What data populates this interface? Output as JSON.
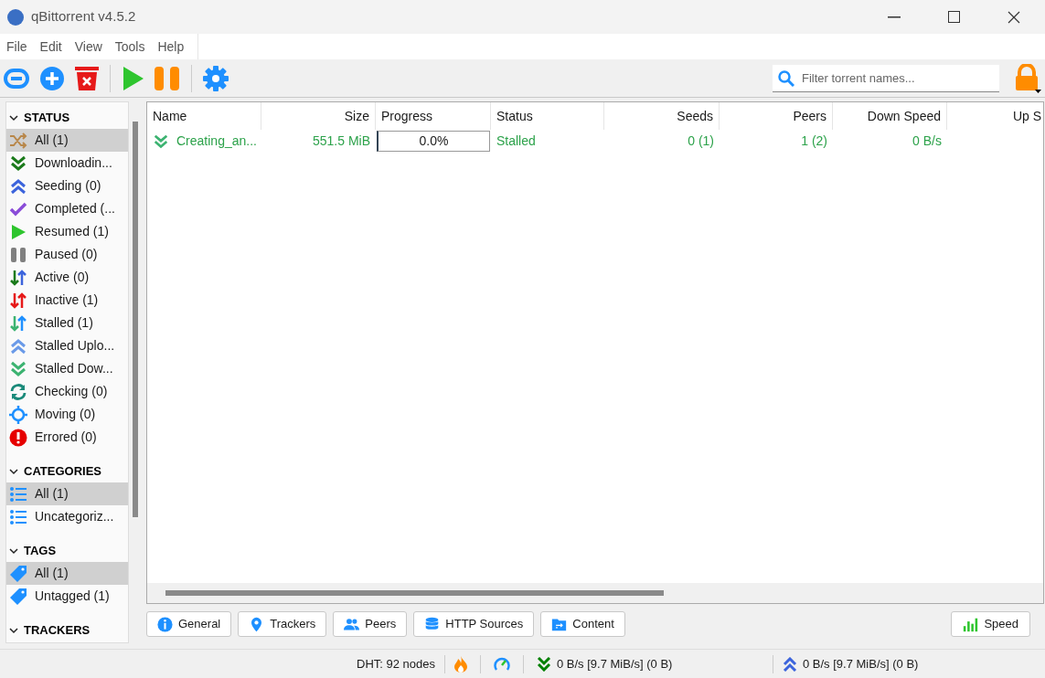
{
  "window": {
    "title": "qBittorrent v4.5.2"
  },
  "menu": [
    "File",
    "Edit",
    "View",
    "Tools",
    "Help"
  ],
  "search": {
    "placeholder": "Filter torrent names..."
  },
  "sidebar": [
    {
      "title": "STATUS",
      "expanded": true,
      "items": [
        {
          "label": "All (1)",
          "kind": "shuffle",
          "selected": true
        },
        {
          "label": "Downloadin...",
          "kind": "down",
          "selected": false
        },
        {
          "label": "Seeding (0)",
          "kind": "up",
          "selected": false
        },
        {
          "label": "Completed (...",
          "kind": "check",
          "selected": false
        },
        {
          "label": "Resumed (1)",
          "kind": "play",
          "selected": false
        },
        {
          "label": "Paused (0)",
          "kind": "pause",
          "selected": false
        },
        {
          "label": "Active (0)",
          "kind": "active",
          "selected": false
        },
        {
          "label": "Inactive (1)",
          "kind": "inactive",
          "selected": false
        },
        {
          "label": "Stalled (1)",
          "kind": "stalled",
          "selected": false
        },
        {
          "label": "Stalled Uplo...",
          "kind": "stalledup",
          "selected": false
        },
        {
          "label": "Stalled Dow...",
          "kind": "stalleddown",
          "selected": false
        },
        {
          "label": "Checking (0)",
          "kind": "checking",
          "selected": false
        },
        {
          "label": "Moving (0)",
          "kind": "moving",
          "selected": false
        },
        {
          "label": "Errored (0)",
          "kind": "error",
          "selected": false
        }
      ]
    },
    {
      "title": "CATEGORIES",
      "expanded": true,
      "items": [
        {
          "label": "All (1)",
          "kind": "list",
          "selected": true
        },
        {
          "label": "Uncategoriz...",
          "kind": "list",
          "selected": false
        }
      ]
    },
    {
      "title": "TAGS",
      "expanded": true,
      "items": [
        {
          "label": "All (1)",
          "kind": "tag",
          "selected": true
        },
        {
          "label": "Untagged (1)",
          "kind": "tag",
          "selected": false
        }
      ]
    },
    {
      "title": "TRACKERS",
      "expanded": true
    }
  ],
  "table": {
    "columns": [
      "Name",
      "Size",
      "Progress",
      "Status",
      "Seeds",
      "Peers",
      "Down Speed",
      "Up S"
    ],
    "rows": [
      {
        "kind": "downloading",
        "name": "Creating_an...",
        "size": "551.5 MiB",
        "progress": "0.0%",
        "level": 0,
        "status": "Stalled",
        "seeds": "0 (1)",
        "peers": "1 (2)",
        "down_speed": "0 B/s"
      }
    ]
  },
  "detail_tabs": [
    {
      "label": "General",
      "kind": "info"
    },
    {
      "label": "Trackers",
      "kind": "pin"
    },
    {
      "label": "Peers",
      "kind": "people"
    },
    {
      "label": "HTTP Sources",
      "kind": "db"
    },
    {
      "label": "Content",
      "kind": "folder"
    }
  ],
  "speed_button": {
    "label": "Speed"
  },
  "status_bar": {
    "dht": "DHT: 92 nodes",
    "download": "0 B/s [9.7 MiB/s] (0 B)",
    "upload": "0 B/s [9.7 MiB/s] (0 B)"
  }
}
